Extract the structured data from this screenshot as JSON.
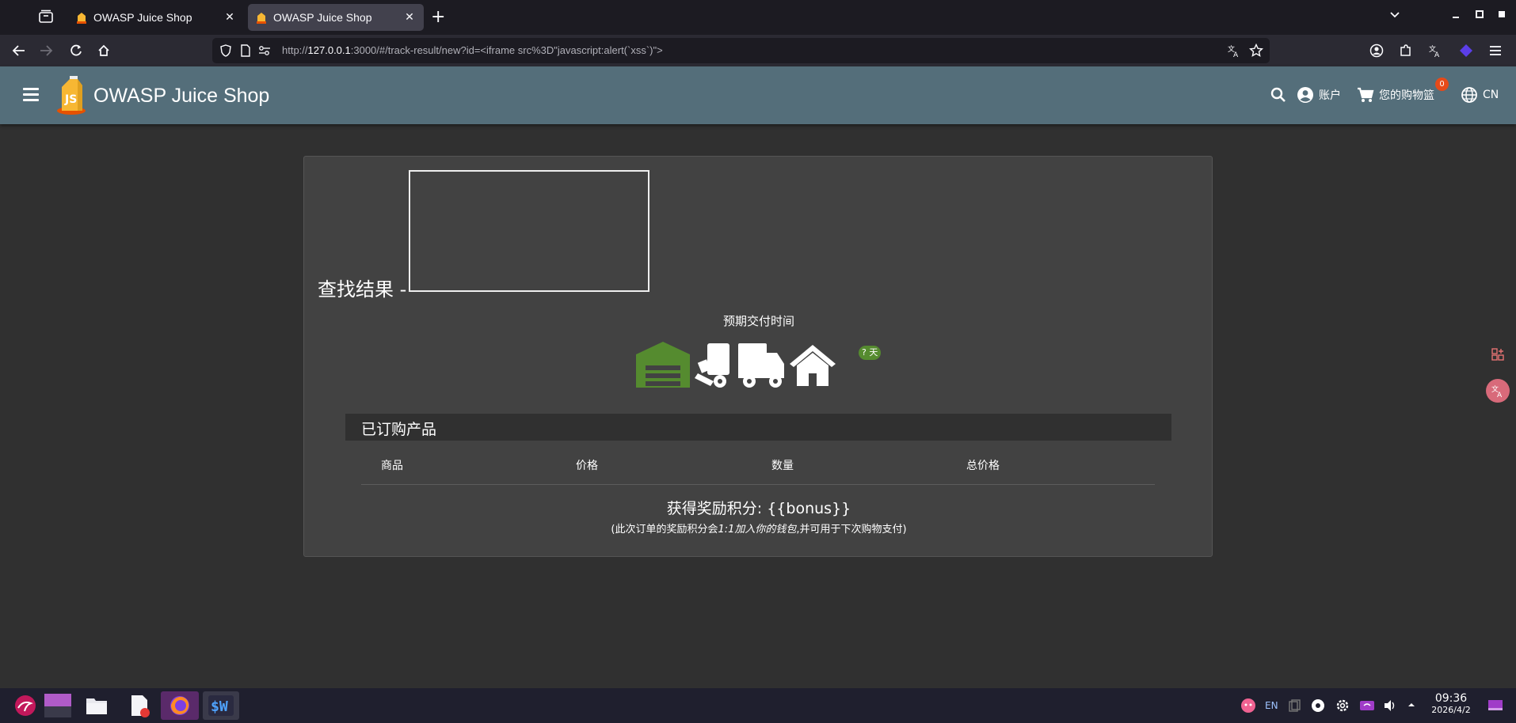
{
  "browser": {
    "tabs": [
      {
        "title": "OWASP Juice Shop",
        "active": false
      },
      {
        "title": "OWASP Juice Shop",
        "active": true
      }
    ],
    "tab_close_glyph": "✕",
    "new_tab_glyph": "+",
    "url_prefix": "http://",
    "url_host": "127.0.0.1",
    "url_rest": ":3000/#/track-result/new?id=<iframe src%3D\"javascript:alert(`xss`)\">"
  },
  "app": {
    "title": "OWASP Juice Shop",
    "account_label": "账户",
    "basket_label": "您的购物篮",
    "basket_count": "0",
    "language_label": "CN"
  },
  "track": {
    "result_title": "查找结果 -",
    "delivery_label": "预期交付时间",
    "days_badge": "? 天",
    "products_title": "已订购产品",
    "columns": [
      "商品",
      "价格",
      "数量",
      "总价格"
    ],
    "bonus_text": "获得奖励积分: {{bonus}}",
    "bonus_note_prefix": "(此次订单的奖励积分会",
    "bonus_note_italic": "1:1加入你的钱包",
    "bonus_note_suffix": ",并可用于下次购物支付)"
  },
  "taskbar": {
    "tray_lang": "EN",
    "time": "09:36",
    "date": "2026/4/2"
  },
  "colors": {
    "appbar": "#546e7a",
    "card": "#424242",
    "background": "#303030",
    "delivery_green": "#558b2f",
    "badge": "#e64a19"
  }
}
